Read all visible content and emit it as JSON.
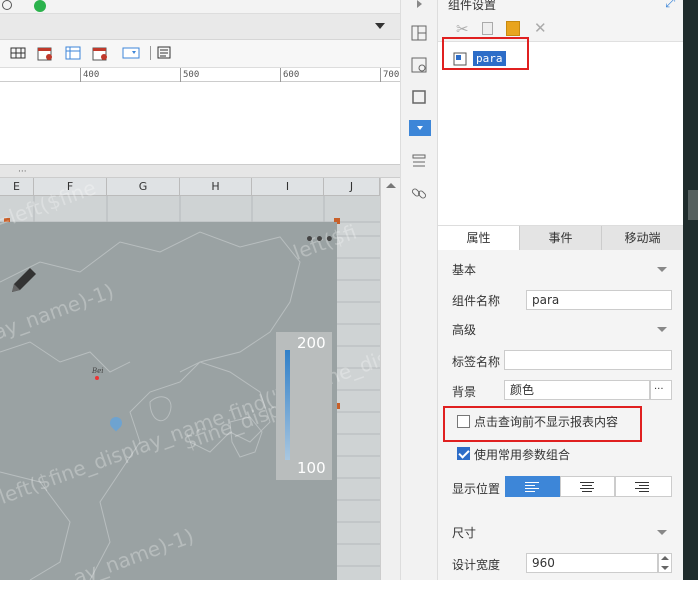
{
  "ruler": {
    "ticks": [
      "400",
      "500",
      "600",
      "700"
    ]
  },
  "columns": [
    "E",
    "F",
    "G",
    "H",
    "I",
    "J"
  ],
  "watermark": {
    "lines": [
      "ay_name)-1)",
      "=left($fine_display_name,find(\"(\",$fine_disp",
      "ay_name)-1)",
      "=left($fine",
      "left($fi",
      "$fine_displ"
    ]
  },
  "legend": {
    "max": "200",
    "min": "100"
  },
  "map": {
    "city_label": "Bei"
  },
  "panel": {
    "title": "组件设置",
    "widget_item": "para",
    "tabs": [
      {
        "label": "属性",
        "active": true
      },
      {
        "label": "事件",
        "active": false
      },
      {
        "label": "移动端",
        "active": false
      }
    ],
    "section_basic": "基本",
    "widget_name_label": "组件名称",
    "widget_name_value": "para",
    "section_advanced": "高级",
    "tag_name_label": "标签名称",
    "tag_name_value": "",
    "background_label": "背景",
    "background_value": "颜色",
    "ellipsis": "···",
    "no_show_before_query": "点击查询前不显示报表内容",
    "use_common_params": "使用常用参数组合",
    "display_position_label": "显示位置",
    "section_size": "尺寸",
    "design_width_label": "设计宽度",
    "design_width_value": "960"
  },
  "colors": {
    "accent": "#2d6dc8",
    "highlight": "#e02020",
    "legend_bar": "#3d86d8"
  }
}
